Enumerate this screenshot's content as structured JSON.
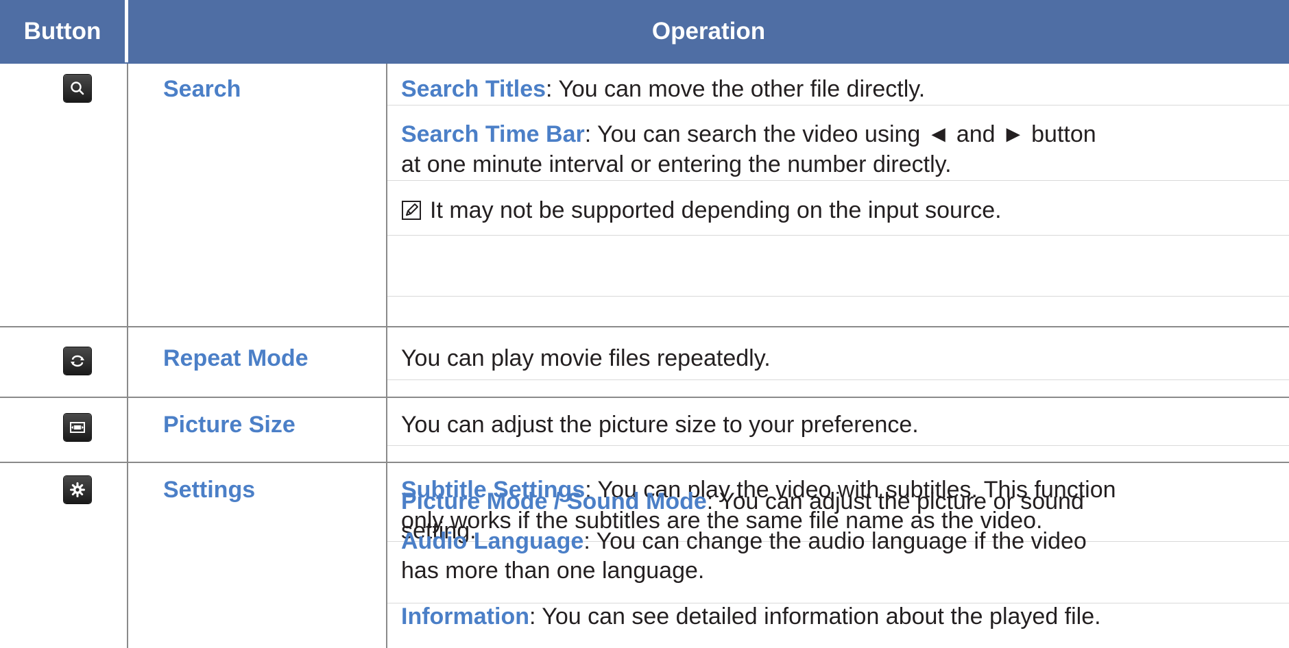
{
  "header": {
    "button": "Button",
    "operation": "Operation"
  },
  "rows": [
    {
      "icon": "search-icon",
      "name": "Search",
      "entries": [
        {
          "keyword": "Search Titles",
          "text": ": You can move the other file directly."
        },
        {
          "keyword": "Search Time Bar",
          "text": ": You can search the video using ◄ and ► button"
        },
        {
          "text": "at one minute interval or entering the number directly."
        }
      ],
      "note": "It may not be supported depending on the input source."
    },
    {
      "icon": "repeat-icon",
      "name": "Repeat Mode",
      "text": "You can play movie files repeatedly."
    },
    {
      "icon": "picture-size-icon",
      "name": "Picture Size",
      "text": "You can adjust the picture size to your preference."
    },
    {
      "icon": "settings-icon",
      "name": "Settings",
      "entries": [
        {
          "keyword": "Subtitle Settings",
          "text": ": You can play the video with subtitles. This function"
        },
        {
          "text": "only works if the subtitles are the same file name as the video."
        },
        {
          "keyword": "Picture Mode / Sound Mode",
          "text": ": You can adjust the picture or sound"
        },
        {
          "text": "setting."
        },
        {
          "keyword": "Audio Language",
          "text": ": You can change the audio language if the video"
        },
        {
          "text": "has more than one language."
        },
        {
          "keyword": "Information",
          "text": ": You can see detailed information about the played file."
        }
      ]
    }
  ]
}
